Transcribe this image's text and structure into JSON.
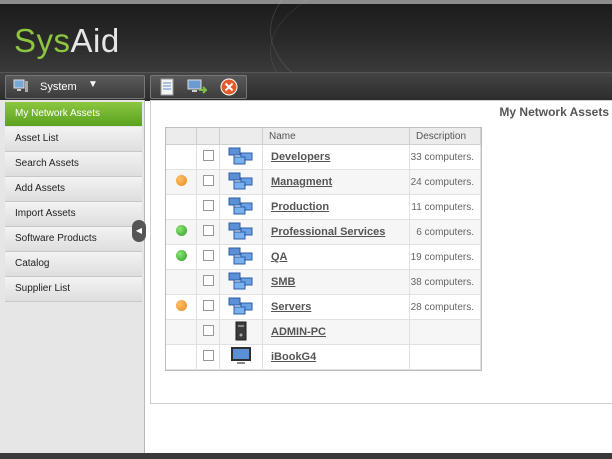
{
  "app": {
    "logo_part1": "Sys",
    "logo_part2": "Aid"
  },
  "toolbar": {
    "system_label": "System",
    "system_icon": "computer-icon",
    "dropdown_icon": "chevron-down-icon",
    "buttons": [
      "list-icon",
      "assets-export-icon",
      "close-icon"
    ]
  },
  "sidebar": {
    "items": [
      {
        "label": "My Network Assets",
        "active": true
      },
      {
        "label": "Asset List"
      },
      {
        "label": "Search Assets"
      },
      {
        "label": "Add Assets"
      },
      {
        "label": "Import Assets"
      },
      {
        "label": "Software Products"
      },
      {
        "label": "Catalog"
      },
      {
        "label": "Supplier List"
      }
    ]
  },
  "main": {
    "title": "My Network Assets",
    "columns": [
      "",
      "",
      "",
      "Name",
      "Description"
    ],
    "rows": [
      {
        "status": "none",
        "icon": "network-group-icon",
        "name": "Developers",
        "desc": "33 computers."
      },
      {
        "status": "orange",
        "icon": "network-group-icon",
        "name": "Managment",
        "desc": "24 computers."
      },
      {
        "status": "none",
        "icon": "network-group-icon",
        "name": "Production",
        "desc": "11 computers."
      },
      {
        "status": "green",
        "icon": "network-group-icon",
        "name": "Professional Services",
        "desc": "6 computers."
      },
      {
        "status": "green",
        "icon": "network-group-icon",
        "name": "QA",
        "desc": "19 computers."
      },
      {
        "status": "none",
        "icon": "network-group-icon",
        "name": "SMB",
        "desc": "38 computers."
      },
      {
        "status": "orange",
        "icon": "network-group-icon",
        "name": "Servers",
        "desc": "28 computers."
      },
      {
        "status": "none",
        "icon": "pc-tower-icon",
        "name": "ADMIN-PC",
        "desc": ""
      },
      {
        "status": "none",
        "icon": "monitor-icon",
        "name": "iBookG4",
        "desc": ""
      }
    ]
  },
  "colors": {
    "accent": "#8dc63f",
    "status_orange": "#e8891a",
    "status_green": "#2e9e1e"
  }
}
